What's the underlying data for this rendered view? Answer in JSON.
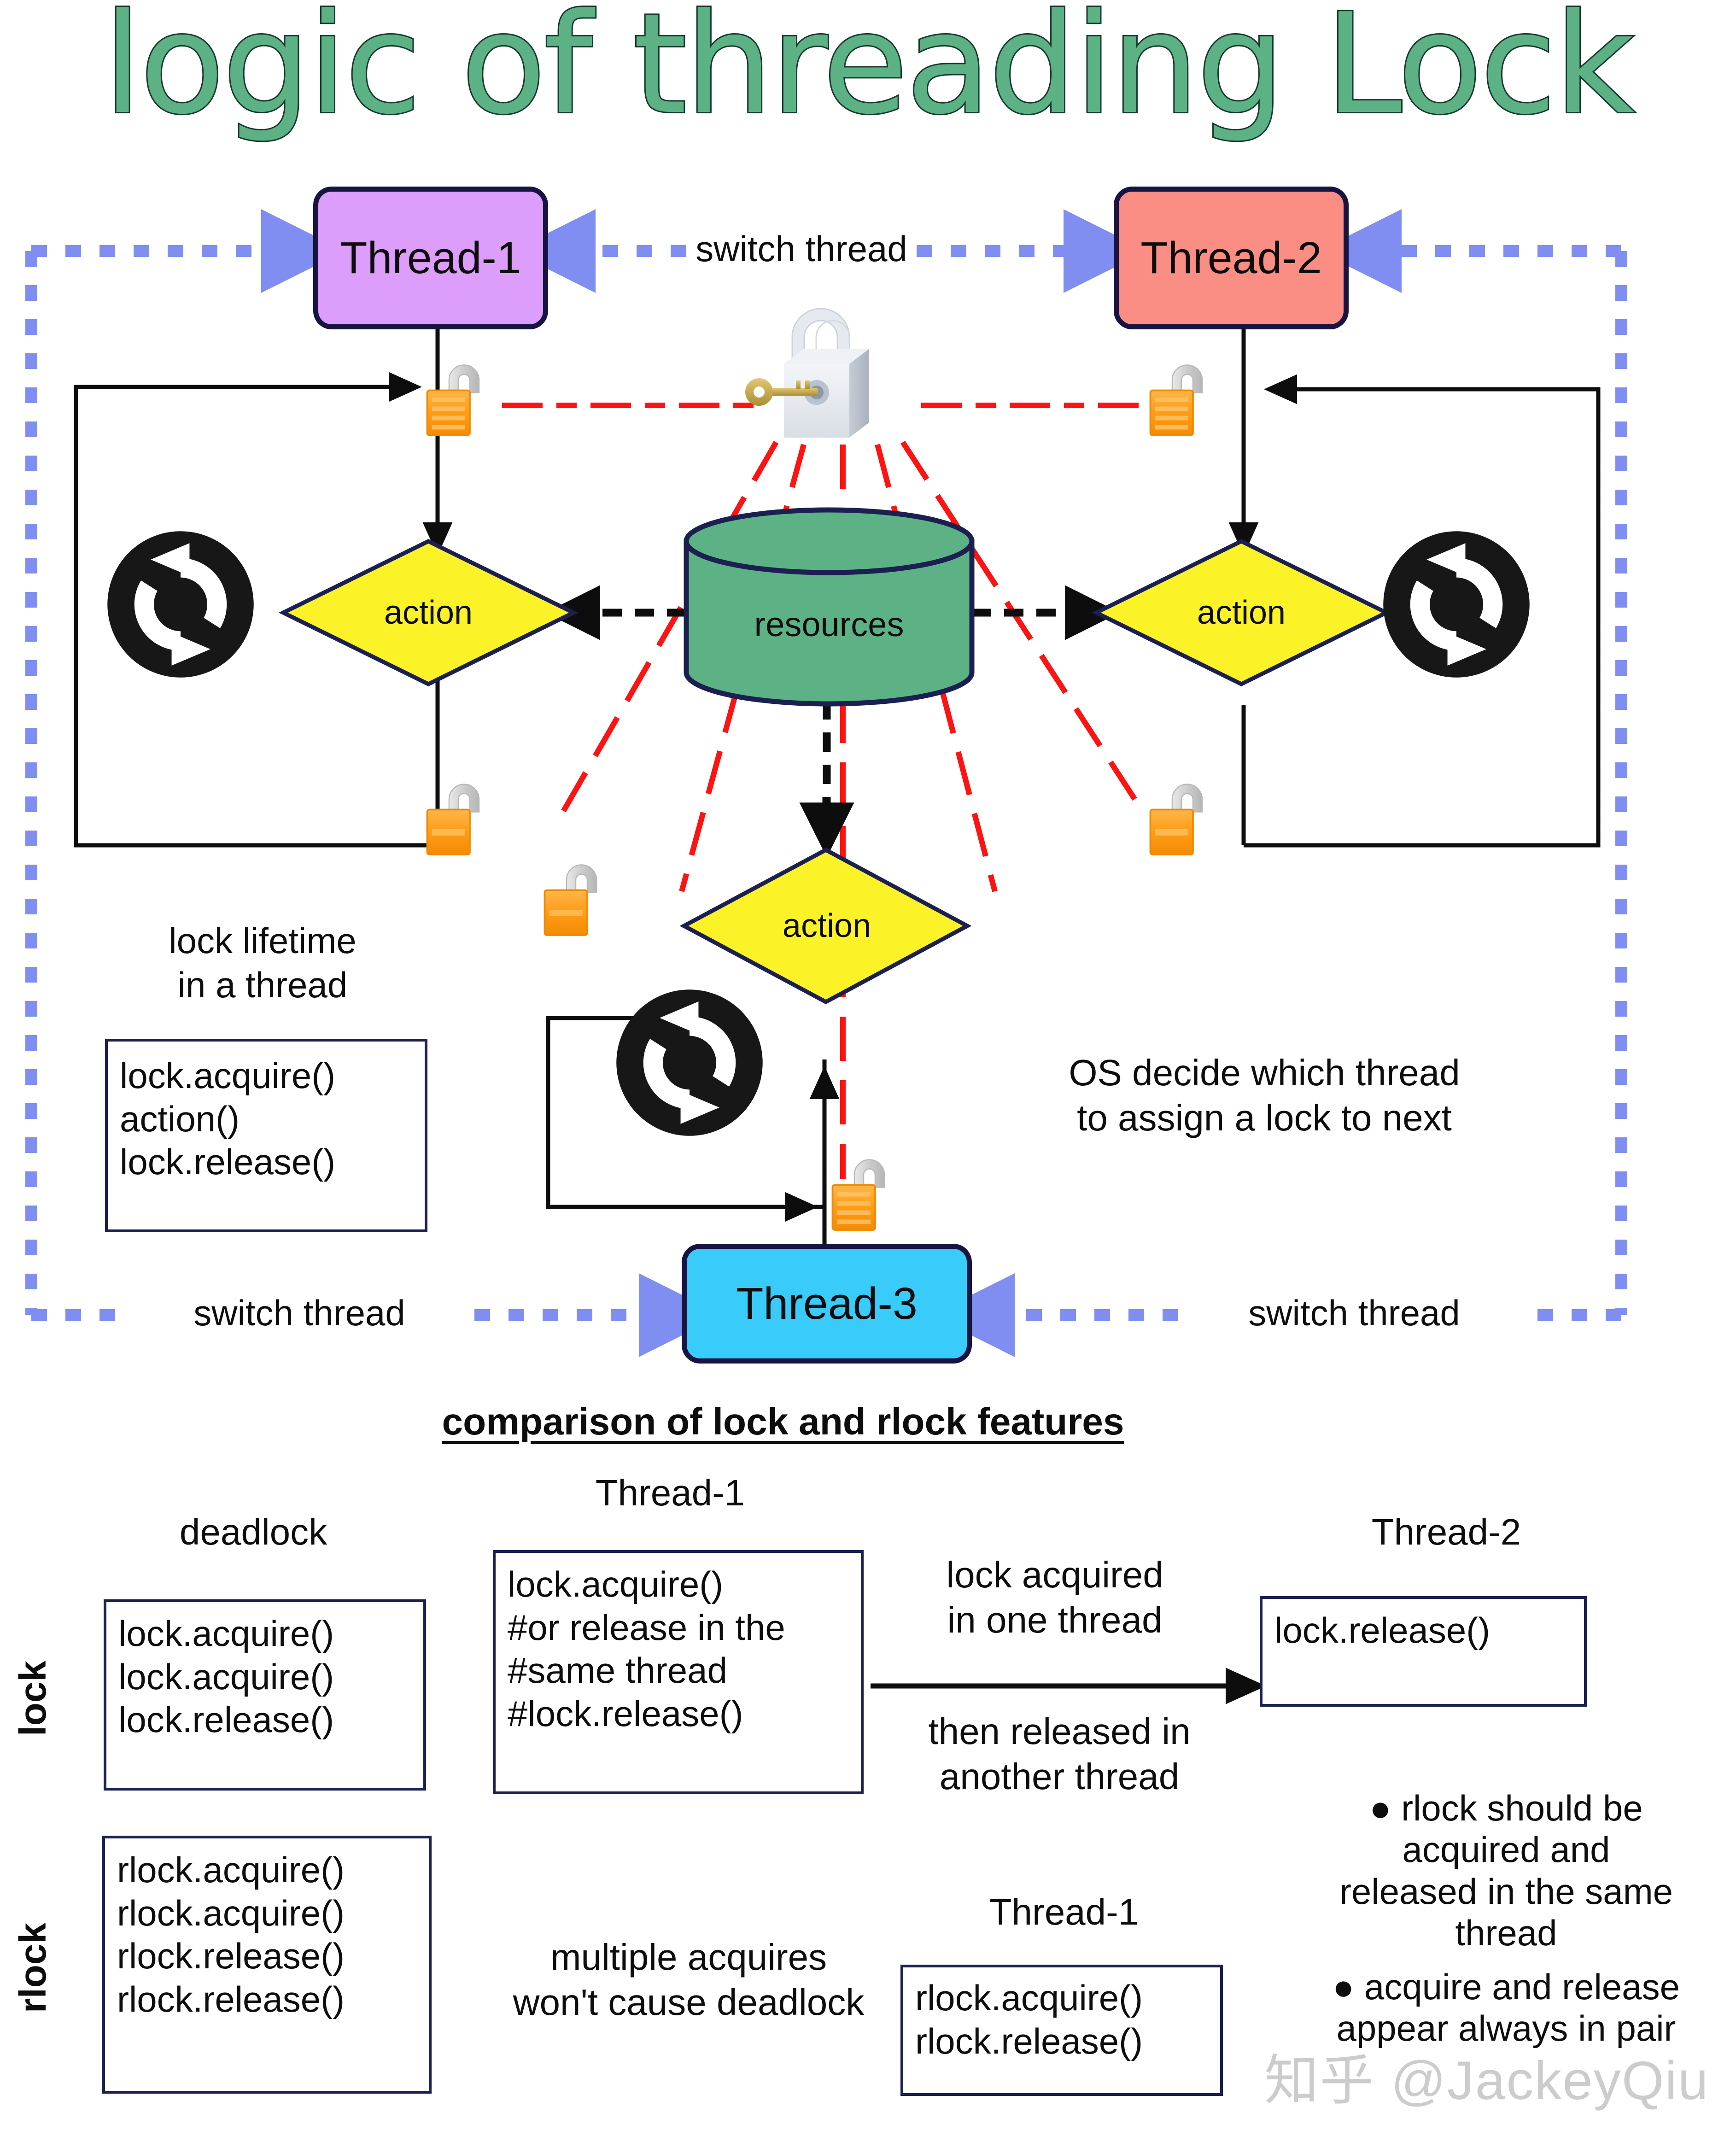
{
  "title": "logic of threading Lock",
  "colors": {
    "title_fill": "#5cb185",
    "title_stroke": "#17392c",
    "thread1_fill": "#dd9dfa",
    "thread2_fill": "#fa8e84",
    "thread3_fill": "#39cbfa",
    "box_border": "#171442",
    "action_fill": "#fbf328",
    "resources_fill": "#5cb185",
    "switch_arrow": "#7f8ef0",
    "lock_line": "#ff1212",
    "padlock_body": "#ff9d17",
    "padlock_shackle": "#cfcfcf",
    "flow_line": "#0d0d0d"
  },
  "diagram": {
    "threads": [
      {
        "id": "thread-1",
        "label": "Thread-1"
      },
      {
        "id": "thread-2",
        "label": "Thread-2"
      },
      {
        "id": "thread-3",
        "label": "Thread-3"
      }
    ],
    "switch_labels": [
      "switch thread",
      "switch thread",
      "switch thread"
    ],
    "actions": [
      "action",
      "action",
      "action"
    ],
    "resources_label": "resources",
    "lock_lifetime_caption": "lock lifetime\nin a thread",
    "lock_lifetime_code": "lock.acquire()\naction()\nlock.release()",
    "os_note": "OS decide which thread\nto assign a lock to next"
  },
  "comparison": {
    "heading": "comparison of lock and rlock features",
    "row_labels": {
      "lock": "lock",
      "rlock": "rlock"
    },
    "lock_row": {
      "deadlock_caption": "deadlock",
      "deadlock_code": "lock.acquire()\nlock.acquire()\nlock.release()",
      "thread1_caption": "Thread-1",
      "thread1_code": "lock.acquire()\n#or release in the\n#same thread\n#lock.release()",
      "arrow_caption_top": "lock acquired\nin one thread",
      "arrow_caption_bottom": "then released in\nanother thread",
      "thread2_caption": "Thread-2",
      "thread2_code": "lock.release()"
    },
    "rlock_row": {
      "rlock_code": "rlock.acquire()\nrlock.acquire()\nrlock.release()\nrlock.release()",
      "note": "multiple acquires\nwon't cause deadlock",
      "thread1_caption": "Thread-1",
      "thread1_code": "rlock.acquire()\nrlock.release()",
      "bullets": [
        "rlock should be acquired and released in the same thread",
        "acquire and release appear always in pair"
      ],
      "bullet_lines": [
        "● rlock should be",
        "acquired and",
        "released in the same",
        "thread",
        "● acquire and release",
        "appear always in pair"
      ]
    }
  },
  "watermark": "知乎 @JackeyQiu",
  "icons": {
    "padlock_open": "padlock-open-icon",
    "padlock_closed_3d": "padlock-3d-icon",
    "key": "key-icon",
    "loop": "loop-refresh-icon"
  }
}
